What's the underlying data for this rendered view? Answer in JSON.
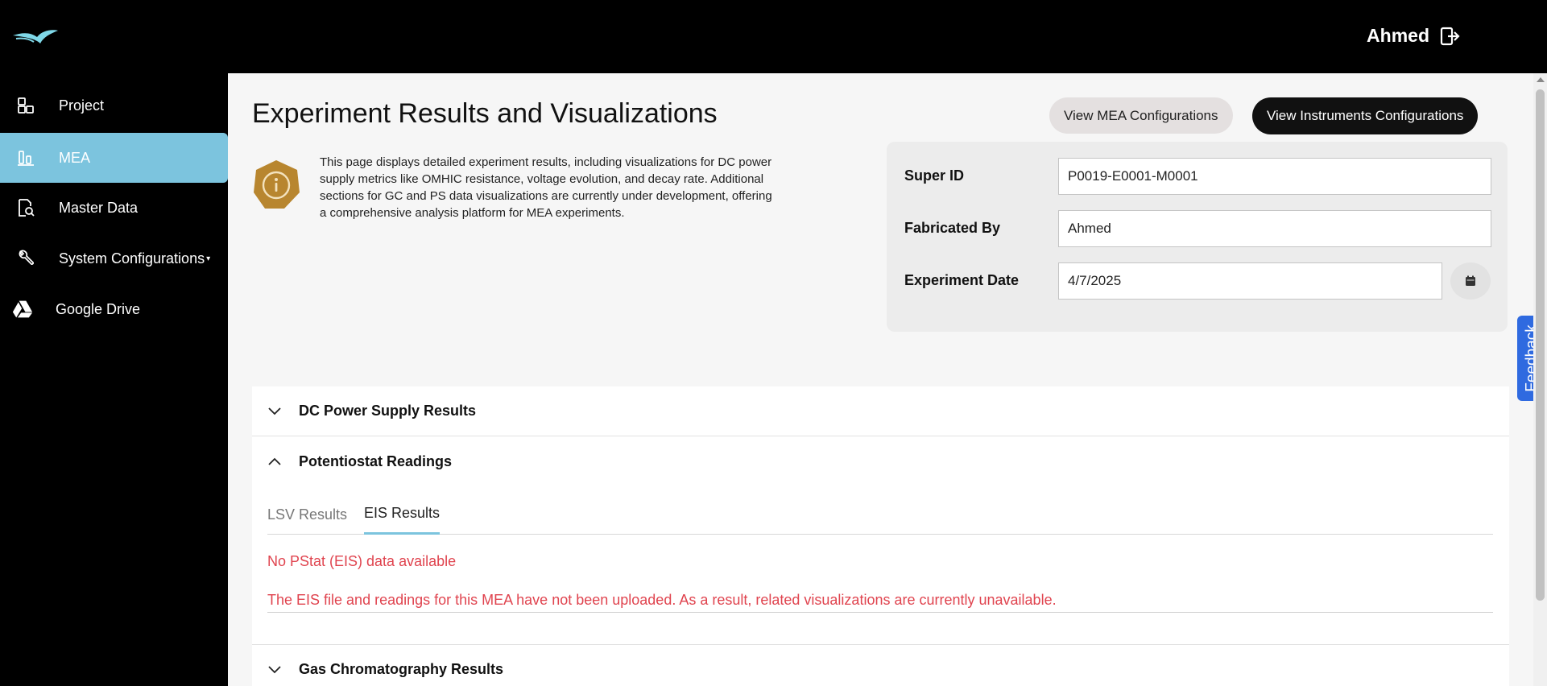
{
  "header": {
    "user_name": "Ahmed",
    "logo_icon": "app-logo",
    "logout_icon": "logout-icon"
  },
  "sidebar": {
    "items": [
      {
        "label": "Project",
        "icon": "project-icon",
        "active": false
      },
      {
        "label": "MEA",
        "icon": "bar-chart-icon",
        "active": true
      },
      {
        "label": "Master Data",
        "icon": "document-icon",
        "active": false
      },
      {
        "label": "System Configurations",
        "icon": "wrench-icon",
        "active": false
      },
      {
        "label": "Google Drive",
        "icon": "google-drive-icon",
        "active": false
      }
    ]
  },
  "main": {
    "title": "Experiment Results and Visualizations",
    "buttons": {
      "mea_config": "View MEA Configurations",
      "instruments_config": "View Instruments Configurations"
    },
    "info": {
      "icon": "info-icon",
      "text": "This page displays detailed experiment results, including visualizations for DC power supply metrics like OMHIC resistance, voltage evolution, and decay rate. Additional sections for GC and PS data visualizations are currently under development, offering a comprehensive analysis platform for MEA experiments."
    },
    "form": {
      "super_id_label": "Super ID",
      "super_id_value": "P0019-E0001-M0001",
      "fabricated_by_label": "Fabricated By",
      "fabricated_by_value": "Ahmed",
      "experiment_date_label": "Experiment Date",
      "experiment_date_value": "4/7/2025"
    },
    "sections": {
      "dc": "DC Power Supply Results",
      "potentiostat": "Potentiostat Readings",
      "gc": "Gas Chromatography Results"
    },
    "tabs": {
      "lsv": "LSV Results",
      "eis": "EIS Results"
    },
    "eis": {
      "no_data": "No PStat (EIS) data available",
      "message": "The EIS file and readings for this MEA have not been uploaded. As a result, related visualizations are currently unavailable."
    }
  },
  "feedback": "Feedback",
  "colors": {
    "accent": "#7cc4de",
    "error": "#e0444f",
    "badge": "#b8862f",
    "feedback": "#2f6ae0"
  }
}
